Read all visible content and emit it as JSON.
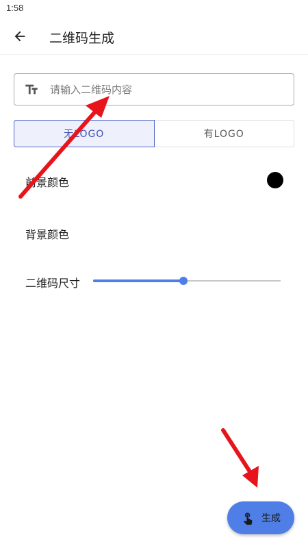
{
  "status_bar": {
    "time": "1:58"
  },
  "app_bar": {
    "title": "二维码生成",
    "back_icon": "arrow-back-icon"
  },
  "input": {
    "placeholder": "请输入二维码内容",
    "value": "",
    "icon": "text-format-icon"
  },
  "logo_toggle": {
    "options": [
      {
        "label": "无LOGO",
        "selected": true
      },
      {
        "label": "有LOGO",
        "selected": false
      }
    ]
  },
  "foreground": {
    "label": "前景颜色",
    "color": "#000000"
  },
  "background": {
    "label": "背景颜色"
  },
  "size": {
    "label": "二维码尺寸",
    "value_fraction": 0.48
  },
  "fab": {
    "label": "生成",
    "icon": "touch-hand-icon"
  },
  "colors": {
    "accent": "#4f7fe6",
    "toggle_selected": "#3f51b5",
    "annotation_arrow": "#e8141c"
  }
}
